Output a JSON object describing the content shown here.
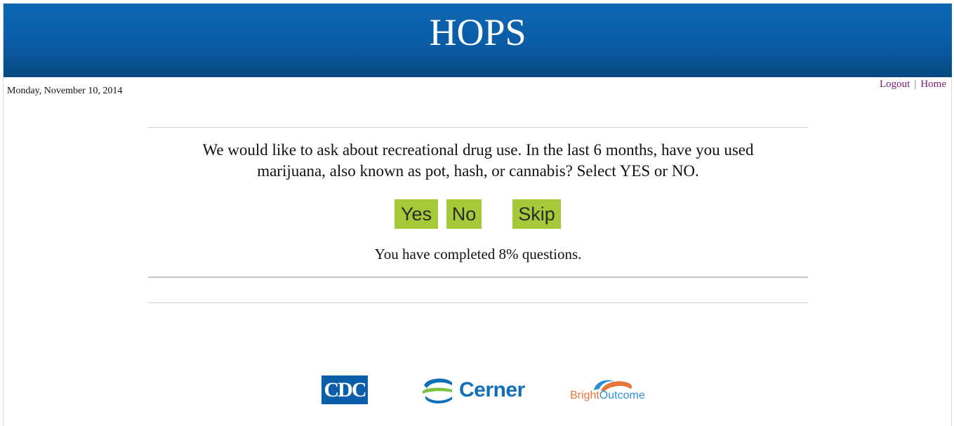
{
  "header": {
    "title": "HOPS"
  },
  "date": "Monday, November 10, 2014",
  "nav": {
    "logout": "Logout",
    "separator": "|",
    "home": "Home"
  },
  "question": {
    "line1": "We would like to ask about recreational drug use. In the last 6 months, have you used",
    "line2": "marijuana, also known as pot, hash, or cannabis? Select YES or NO."
  },
  "buttons": {
    "yes": "Yes",
    "no": "No",
    "skip": "Skip"
  },
  "progress": {
    "text": "You have completed 8% questions.",
    "percent": 8
  },
  "logos": {
    "cdc": "CDC",
    "cerner": "Cerner",
    "bright_part1": "Bright",
    "bright_part2": "Outcome"
  },
  "colors": {
    "header_blue": "#0a5ca6",
    "button_green": "#a6c939",
    "link_purple": "#7a1a6f",
    "cerner_blue": "#0f6fb7",
    "bright_orange": "#e8763a"
  }
}
